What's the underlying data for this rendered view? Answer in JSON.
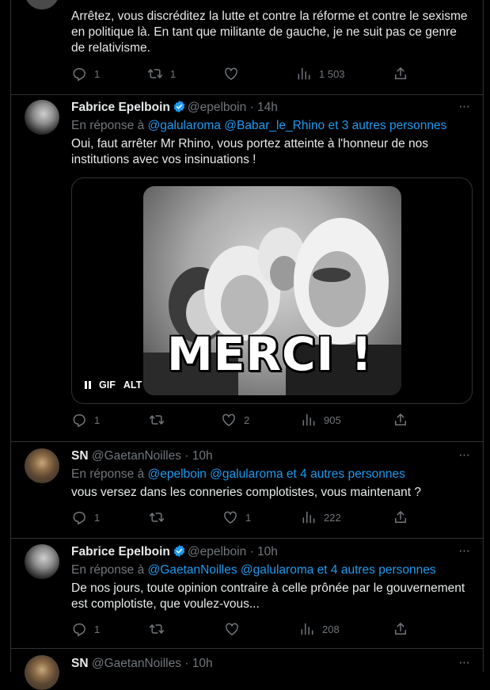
{
  "tweets": [
    {
      "text": "Arrêtez, vous discréditez la lutte et contre la réforme et contre le sexisme en politique là. En tant que militante de gauche, je ne suit pas ce genre de relativisme.",
      "replies": "1",
      "retweets": "1",
      "likes": "",
      "views": "1 503"
    },
    {
      "name": "Fabrice Epelboin",
      "handle": "@epelboin",
      "time": "14h",
      "reply_prefix": "En réponse à",
      "reply_users": "@galularoma @Babar_le_Rhino",
      "reply_others": "et 3 autres personnes",
      "text": "Oui, faut arrêter Mr Rhino, vous portez atteinte à l'honneur de nos institutions avec vos insinuations !",
      "media": {
        "caption": "MERCI !",
        "gif_badge": "GIF",
        "alt_badge": "ALT"
      },
      "replies": "1",
      "retweets": "",
      "likes": "2",
      "views": "905"
    },
    {
      "name": "SN",
      "handle": "@GaetanNoilles",
      "time": "10h",
      "reply_prefix": "En réponse à",
      "reply_users": "@epelboin @galularoma",
      "reply_others": "et 4 autres personnes",
      "text": "vous versez dans les conneries complotistes, vous maintenant ?",
      "replies": "1",
      "retweets": "",
      "likes": "1",
      "views": "222"
    },
    {
      "name": "Fabrice Epelboin",
      "handle": "@epelboin",
      "time": "10h",
      "reply_prefix": "En réponse à",
      "reply_users": "@GaetanNoilles @galularoma",
      "reply_others": "et 4 autres personnes",
      "text": "De nos jours, toute opinion contraire à celle prônée par le gouvernement est complotiste, que voulez-vous...",
      "replies": "1",
      "retweets": "",
      "likes": "",
      "views": "208"
    },
    {
      "name": "SN",
      "handle": "@GaetanNoilles",
      "time": "10h"
    }
  ],
  "separator": "·",
  "more": "···",
  "colors": {
    "background": "#000000",
    "text": "#e7e9ea",
    "muted": "#71767b",
    "link": "#1d9bf0",
    "border": "#2f3336"
  },
  "icons": [
    "reply-icon",
    "retweet-icon",
    "like-icon",
    "views-icon",
    "share-icon",
    "verified-badge-icon",
    "more-icon",
    "pause-icon"
  ]
}
